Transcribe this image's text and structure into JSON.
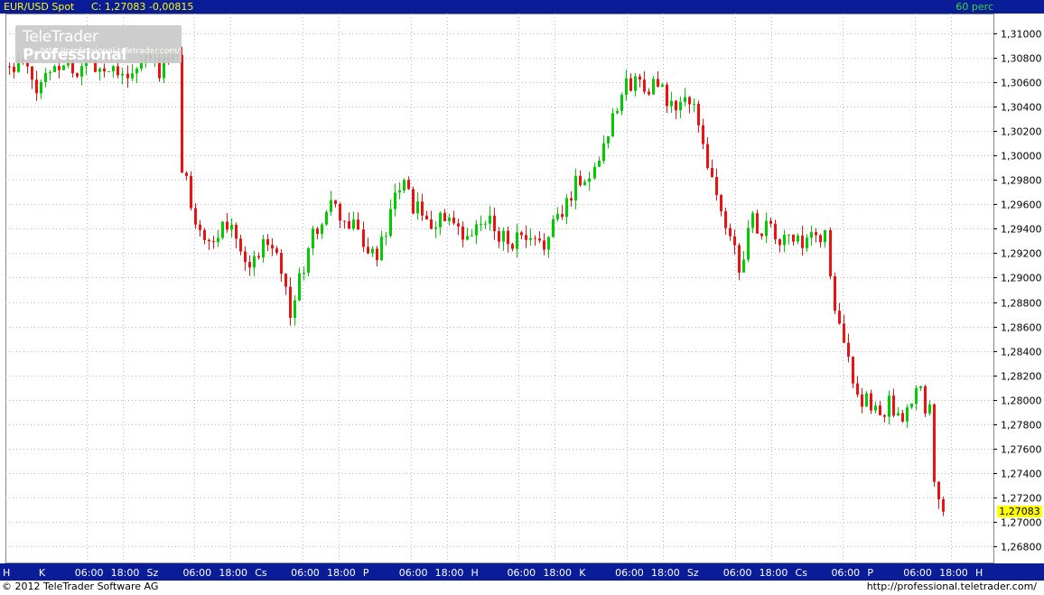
{
  "header": {
    "symbol": "EUR/USD Spot",
    "price_text": "C: 1,27083 -0,00815",
    "period": "60 perc"
  },
  "logo": {
    "brand_light": "TeleTrader ",
    "brand_bold": "Professional",
    "url": "http://professional.teletrader.com/"
  },
  "footer": {
    "copyright": "© 2012  TeleTrader Software AG",
    "url": "http://professional.teletrader.com/"
  },
  "colors": {
    "up": "#00cc00",
    "down": "#ee1111",
    "header_bg": "#0b1c98",
    "header_text": "#ffff00",
    "period_text": "#33dd33",
    "grid": "#bbbbbb",
    "axis_band": "#0b1c98"
  },
  "chart_data": {
    "type": "candlestick",
    "last_price_label": "1,27083",
    "ylim": [
      1.2665,
      1.3125
    ],
    "y_ticks": [
      {
        "value": 1.31,
        "label": "1,31000"
      },
      {
        "value": 1.308,
        "label": "1,30800"
      },
      {
        "value": 1.306,
        "label": "1,30600"
      },
      {
        "value": 1.304,
        "label": "1,30400"
      },
      {
        "value": 1.302,
        "label": "1,30200"
      },
      {
        "value": 1.3,
        "label": "1,30000"
      },
      {
        "value": 1.298,
        "label": "1,29800"
      },
      {
        "value": 1.296,
        "label": "1,29600"
      },
      {
        "value": 1.294,
        "label": "1,29400"
      },
      {
        "value": 1.292,
        "label": "1,29200"
      },
      {
        "value": 1.29,
        "label": "1,29000"
      },
      {
        "value": 1.288,
        "label": "1,28800"
      },
      {
        "value": 1.286,
        "label": "1,28600"
      },
      {
        "value": 1.284,
        "label": "1,28400"
      },
      {
        "value": 1.282,
        "label": "1,28200"
      },
      {
        "value": 1.28,
        "label": "1,28000"
      },
      {
        "value": 1.278,
        "label": "1,27800"
      },
      {
        "value": 1.276,
        "label": "1,27600"
      },
      {
        "value": 1.274,
        "label": "1,27400"
      },
      {
        "value": 1.272,
        "label": "1,27200"
      },
      {
        "value": 1.27,
        "label": "1,27000"
      },
      {
        "value": 1.268,
        "label": "1,26800"
      }
    ],
    "x_labels": [
      "H",
      "K",
      "06:00",
      "18:00",
      "Sz",
      "06:00",
      "18:00",
      "Cs",
      "06:00",
      "18:00",
      "P",
      "06:00",
      "18:00",
      "H",
      "06:00",
      "18:00",
      "K",
      "06:00",
      "18:00",
      "Sz",
      "06:00",
      "18:00",
      "Cs",
      "06:00",
      "P",
      "06:00",
      "18:00",
      "H"
    ],
    "path": [
      [
        0,
        1.307
      ],
      [
        3,
        1.3075
      ],
      [
        6,
        1.3052
      ],
      [
        9,
        1.3072
      ],
      [
        12,
        1.3078
      ],
      [
        15,
        1.3068
      ],
      [
        18,
        1.3078
      ],
      [
        21,
        1.3071
      ],
      [
        24,
        1.3074
      ],
      [
        27,
        1.3063
      ],
      [
        30,
        1.3079
      ],
      [
        33,
        1.3072
      ],
      [
        36,
        1.3079
      ],
      [
        37,
        1.3079
      ],
      [
        38,
        1.299
      ],
      [
        41,
        1.295
      ],
      [
        44,
        1.2922
      ],
      [
        47,
        1.2942
      ],
      [
        50,
        1.294
      ],
      [
        53,
        1.2905
      ],
      [
        56,
        1.2932
      ],
      [
        59,
        1.2928
      ],
      [
        62,
        1.287
      ],
      [
        65,
        1.291
      ],
      [
        68,
        1.2942
      ],
      [
        71,
        1.2958
      ],
      [
        74,
        1.2945
      ],
      [
        77,
        1.2938
      ],
      [
        80,
        1.2915
      ],
      [
        83,
        1.2932
      ],
      [
        86,
        1.2978
      ],
      [
        89,
        1.296
      ],
      [
        92,
        1.2942
      ],
      [
        95,
        1.295
      ],
      [
        98,
        1.2938
      ],
      [
        101,
        1.2928
      ],
      [
        104,
        1.2945
      ],
      [
        107,
        1.2942
      ],
      [
        110,
        1.293
      ],
      [
        113,
        1.293
      ],
      [
        116,
        1.2925
      ],
      [
        119,
        1.2935
      ],
      [
        122,
        1.2952
      ],
      [
        125,
        1.298
      ],
      [
        128,
        1.2982
      ],
      [
        131,
        1.301
      ],
      [
        134,
        1.3045
      ],
      [
        137,
        1.306
      ],
      [
        140,
        1.306
      ],
      [
        143,
        1.3055
      ],
      [
        146,
        1.3038
      ],
      [
        149,
        1.3045
      ],
      [
        152,
        1.303
      ],
      [
        155,
        1.298
      ],
      [
        158,
        1.294
      ],
      [
        161,
        1.2912
      ],
      [
        164,
        1.2945
      ],
      [
        167,
        1.294
      ],
      [
        170,
        1.293
      ],
      [
        173,
        1.293
      ],
      [
        176,
        1.2925
      ],
      [
        179,
        1.2935
      ],
      [
        180,
        1.2935
      ],
      [
        182,
        1.287
      ],
      [
        185,
        1.283
      ],
      [
        188,
        1.28
      ],
      [
        191,
        1.279
      ],
      [
        194,
        1.2795
      ],
      [
        197,
        1.2775
      ],
      [
        200,
        1.281
      ],
      [
        203,
        1.279
      ],
      [
        204,
        1.274
      ],
      [
        205,
        1.2718
      ],
      [
        206,
        1.27083
      ]
    ]
  }
}
